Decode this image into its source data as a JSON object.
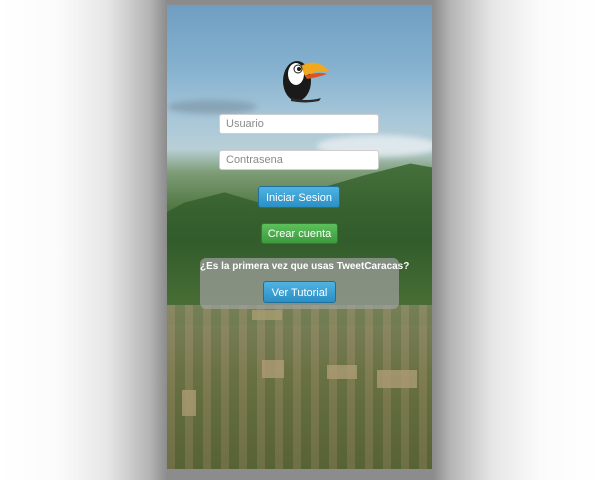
{
  "login_form": {
    "username_placeholder": "Usuario",
    "password_placeholder": "Contrasena",
    "login_button_label": "Iniciar Sesion",
    "signup_button_label": "Crear cuenta"
  },
  "tutorial": {
    "question": "¿Es la primera vez que usas TweetCaracas?",
    "button_label": "Ver Tutorial"
  },
  "colors": {
    "login_button": "#2b8fc4",
    "signup_button": "#3c9a3c",
    "tutorial_panel": "#a0a0a0"
  },
  "icons": {
    "logo": "toucan-icon"
  }
}
